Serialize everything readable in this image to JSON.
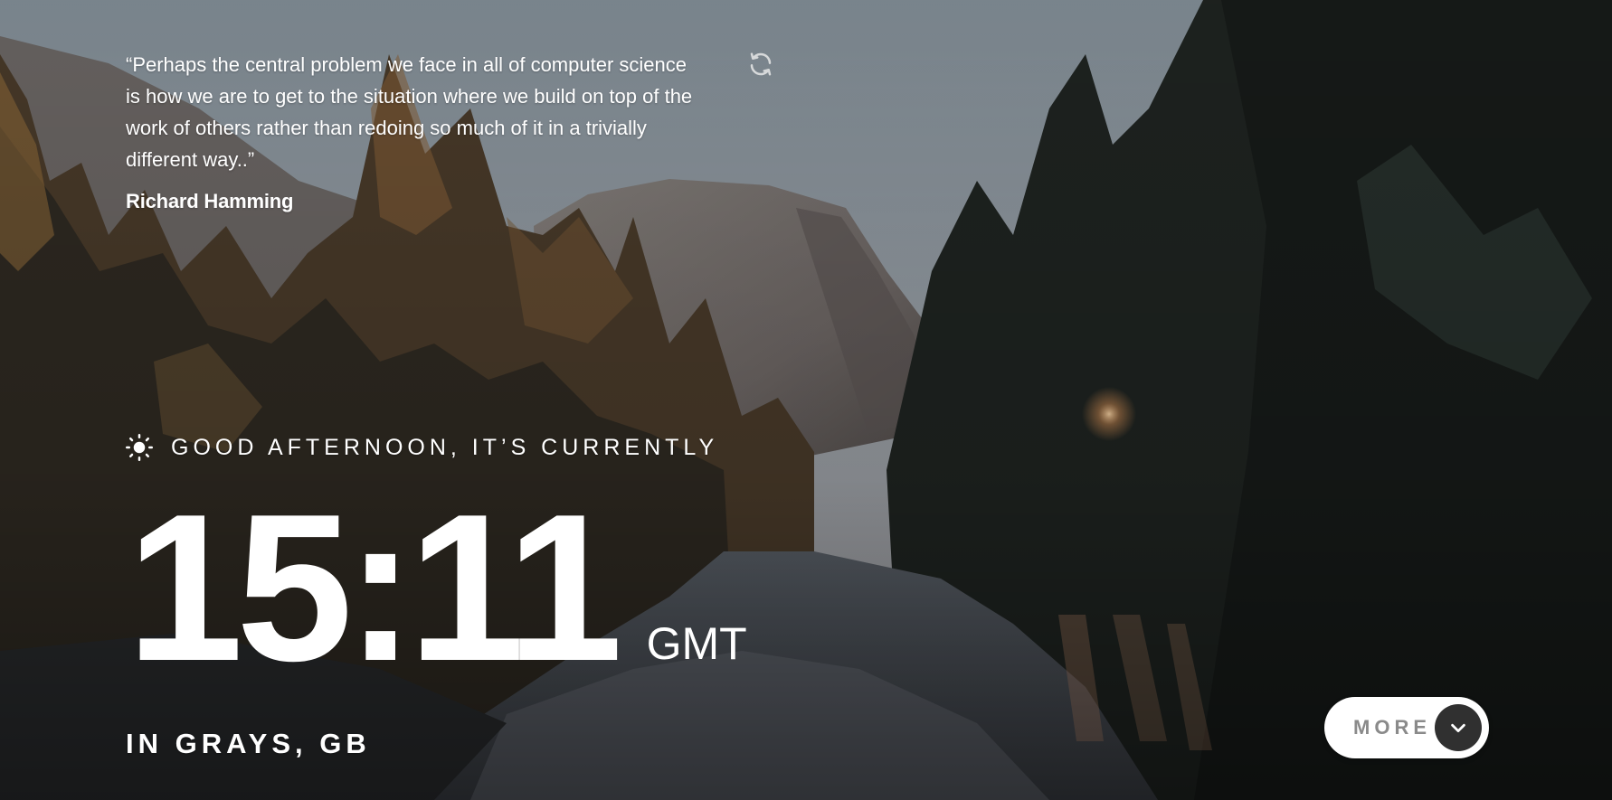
{
  "quote": {
    "text": "“Perhaps the central problem we face in all of computer science is how we are to get to the situation where we build on top of the work of others rather than redoing so much of it in a trivially different way..”",
    "author": "Richard Hamming"
  },
  "greeting": {
    "text": "GOOD AFTERNOON, IT’S CURRENTLY",
    "icon": "sun-icon"
  },
  "clock": {
    "time": "15:11",
    "timezone": "GMT"
  },
  "location": {
    "text": "IN GRAYS, GB"
  },
  "more_button": {
    "label": "MORE",
    "icon": "chevron-down-icon"
  },
  "colors": {
    "text": "#ffffff",
    "button_bg": "#ffffff",
    "button_label": "#8a8a8a",
    "button_circle": "#303030",
    "sky": "#8e9aa2",
    "forest_dark": "#1f2421"
  }
}
